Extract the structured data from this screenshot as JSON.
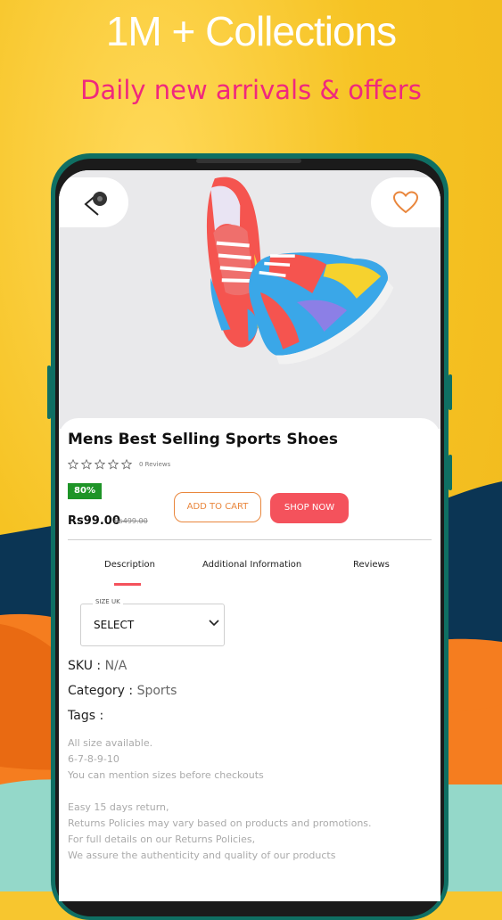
{
  "banner": {
    "headline": "1M + Collections",
    "subheadline": "Daily new arrivals & offers"
  },
  "colors": {
    "background_yellow": "#f6c323",
    "navy": "#0b3554",
    "orange": "#f57d1f",
    "mint": "#94d8c9",
    "headline_pink": "#f0287d",
    "accent_red": "#f4525c",
    "accent_orange": "#e9863c",
    "badge_green": "#1e9427"
  },
  "icons": {
    "back": "arrow-left-icon",
    "favorite": "heart-outline-icon",
    "rating": "star-outline-icon",
    "select": "chevron-down-icon"
  },
  "product": {
    "title": "Mens Best Selling Sports Shoes",
    "rating": 0,
    "rating_max": 5,
    "reviews": "0 Reviews",
    "discount": "80%",
    "price": "Rs99.00",
    "old_price": "Rs499.00",
    "add_to_cart": "ADD TO CART",
    "shop_now": "SHOP NOW"
  },
  "tabs": [
    {
      "label": "Description",
      "active": true
    },
    {
      "label": "Additional Information",
      "active": false
    },
    {
      "label": "Reviews",
      "active": false
    }
  ],
  "size_select": {
    "label": "SIZE UK",
    "value": "SELECT"
  },
  "meta": {
    "sku_label": "SKU :",
    "sku_value": "N/A",
    "category_label": "Category :",
    "category_value": "Sports",
    "tags_label": "Tags :"
  },
  "description_lines": [
    "All size available.",
    "6-7-8-9-10",
    "You can mention sizes before checkouts",
    "",
    "Easy 15 days return,",
    "Returns Policies may vary based on products and promotions.",
    "For full details on our Returns Policies,",
    "We assure the authenticity and quality of our products"
  ]
}
